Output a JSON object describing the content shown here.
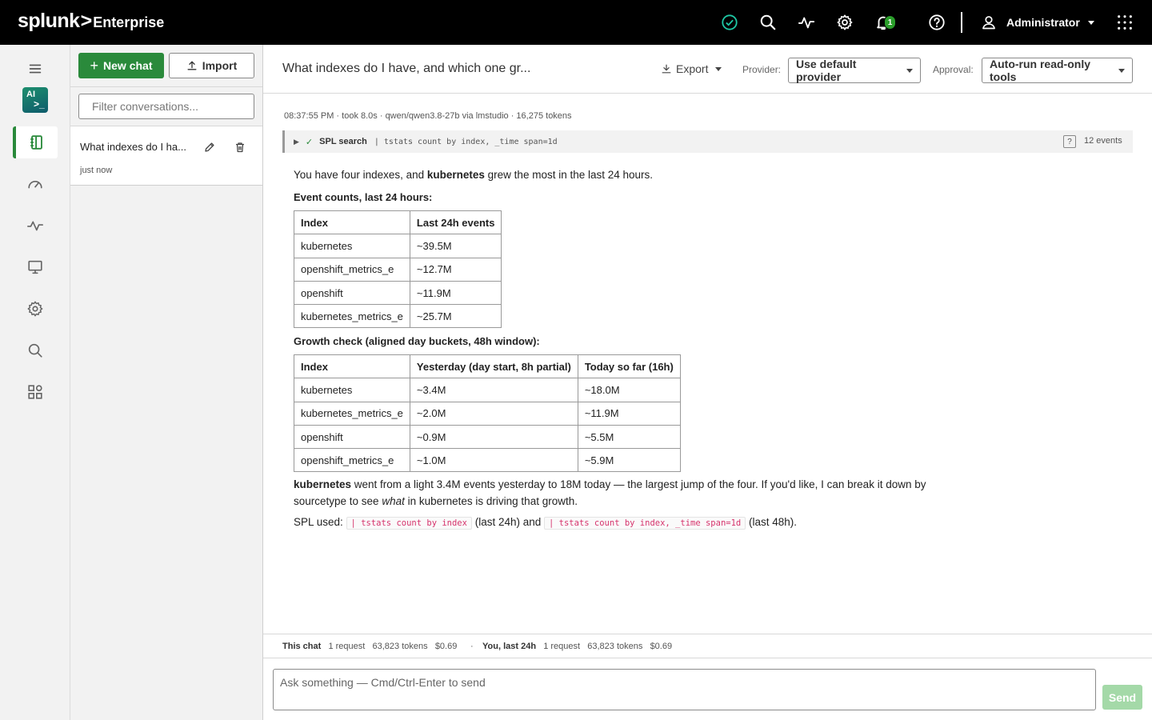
{
  "topbar": {
    "brand_name": "splunk",
    "brand_gt": ">",
    "brand_product": "Enterprise",
    "notification_count": "1",
    "user_name": "Administrator"
  },
  "sidebar": {
    "app_logo_text": "AI",
    "app_logo_prompt": ">_"
  },
  "conversations": {
    "new_chat_label": "New chat",
    "new_chat_plus": "+",
    "import_label": "Import",
    "filter_placeholder": "Filter conversations...",
    "items": [
      {
        "title": "What indexes do I ha...",
        "time": "just now"
      }
    ]
  },
  "header": {
    "title": "What indexes do I have, and which one gr...",
    "export_label": "Export",
    "provider_label": "Provider:",
    "provider_value": "Use default provider",
    "approval_label": "Approval:",
    "approval_value": "Auto-run read-only tools"
  },
  "message": {
    "meta": "08:37:55 PM · took 8.0s · qwen/qwen3.8-27b via lmstudio · 16,275 tokens",
    "spl": {
      "toggle": "▶",
      "check": "✓",
      "label": "SPL search",
      "query": "| tstats count by index, _time span=1d",
      "help": "?",
      "events": "12 events"
    },
    "intro_pre": "You have four indexes, and ",
    "intro_bold": "kubernetes",
    "intro_post": " grew the most in the last 24 hours.",
    "table1_heading": "Event counts, last 24 hours:",
    "table1": {
      "headers": [
        "Index",
        "Last 24h events"
      ],
      "rows": [
        [
          "kubernetes",
          "~39.5M"
        ],
        [
          "openshift_metrics_e",
          "~12.7M"
        ],
        [
          "openshift",
          "~11.9M"
        ],
        [
          "kubernetes_metrics_e",
          "~25.7M"
        ]
      ]
    },
    "table2_heading": "Growth check (aligned day buckets, 48h window):",
    "table2": {
      "headers": [
        "Index",
        "Yesterday (day start, 8h partial)",
        "Today so far (16h)"
      ],
      "rows": [
        [
          "kubernetes",
          "~3.4M",
          "~18.0M"
        ],
        [
          "kubernetes_metrics_e",
          "~2.0M",
          "~11.9M"
        ],
        [
          "openshift",
          "~0.9M",
          "~5.5M"
        ],
        [
          "openshift_metrics_e",
          "~1.0M",
          "~5.9M"
        ]
      ]
    },
    "summary1_bold": "kubernetes",
    "summary1_rest": " went from a light 3.4M events yesterday to 18M today — the largest jump of the four. If you'd like, I can break it down by",
    "summary2_pre": "sourcetype to see ",
    "summary2_em": "what",
    "summary2_post": " in kubernetes is driving that growth.",
    "spl_used_label": "SPL used: ",
    "spl_used_code1": "| tstats count by index",
    "spl_used_mid": " (last 24h) and ",
    "spl_used_code2": "| tstats count by index, _time span=1d",
    "spl_used_end": " (last 48h)."
  },
  "footer": {
    "this_chat_label": "This chat",
    "this_chat_requests": "1 request",
    "this_chat_tokens": "63,823 tokens",
    "this_chat_cost": "$0.69",
    "dot": "·",
    "you_label": "You, last 24h",
    "you_requests": "1 request",
    "you_tokens": "63,823 tokens",
    "you_cost": "$0.69"
  },
  "composer": {
    "placeholder": "Ask something — Cmd/Ctrl-Enter to send",
    "send_label": "Send"
  },
  "colors": {
    "accent_green": "#2a8a3b",
    "topbar_bg": "#000000",
    "status_ok": "#1ec8a5",
    "code_text": "#d6336c"
  },
  "icons": {
    "topbar": [
      "health-ok-icon",
      "search-icon",
      "activity-icon",
      "gear-icon",
      "bell-icon",
      "help-icon",
      "user-icon",
      "app-grid-icon"
    ],
    "rail": [
      "menu-icon",
      "notebook-icon",
      "gauge-icon",
      "activity-icon",
      "monitor-icon",
      "gear-icon",
      "search-icon",
      "apps-icon"
    ]
  }
}
